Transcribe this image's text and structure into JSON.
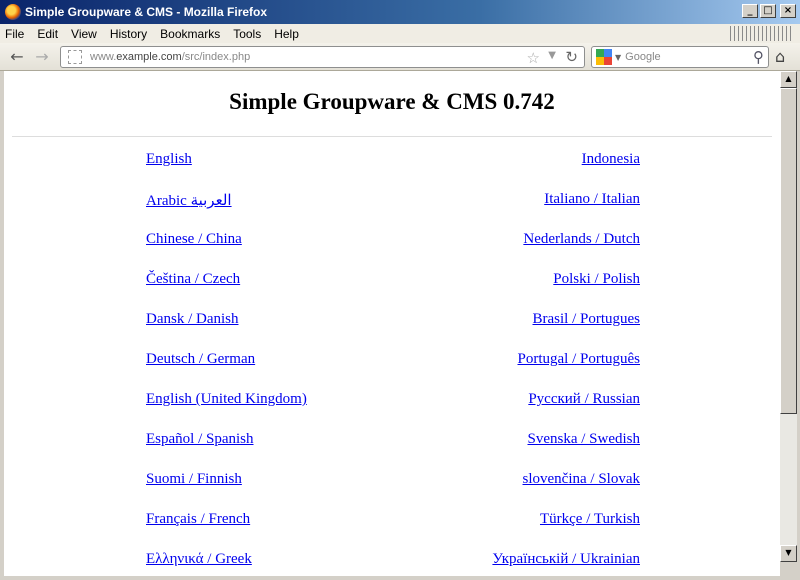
{
  "window": {
    "title": "Simple Groupware & CMS - Mozilla Firefox",
    "buttons": {
      "minimize": "_",
      "maximize": "□",
      "close": "×"
    }
  },
  "menubar": {
    "items": [
      "File",
      "Edit",
      "View",
      "History",
      "Bookmarks",
      "Tools",
      "Help"
    ]
  },
  "navbar": {
    "back_icon": "←",
    "forward_icon": "→",
    "url_prefix": "www.",
    "url_host": "example.com",
    "url_path": "/src/index.php",
    "star_icon": "☆",
    "dropdown_icon": "▼",
    "reload_icon": "↻",
    "search_placeholder": "Google",
    "search_icon": "⚲",
    "home_icon": "⌂",
    "engine_dropdown_icon": "▼"
  },
  "page": {
    "heading": "Simple Groupware & CMS 0.742",
    "languages": [
      {
        "left": "English",
        "right": "Indonesia"
      },
      {
        "left": "Arabic العربية",
        "right": "Italiano / Italian"
      },
      {
        "left": "Chinese / China",
        "right": "Nederlands / Dutch"
      },
      {
        "left": "Čeština / Czech",
        "right": "Polski / Polish"
      },
      {
        "left": "Dansk / Danish",
        "right": "Brasil / Portugues"
      },
      {
        "left": "Deutsch / German",
        "right": "Portugal / Português"
      },
      {
        "left": "English (United Kingdom)",
        "right": "Русский / Russian"
      },
      {
        "left": "Español / Spanish",
        "right": "Svenska / Swedish"
      },
      {
        "left": "Suomi / Finnish",
        "right": "slovenčina / Slovak"
      },
      {
        "left": "Français / French",
        "right": "Türkçe / Turkish"
      },
      {
        "left": "Ελληνικά / Greek",
        "right": "Українській / Ukrainian"
      }
    ]
  },
  "scrollbar": {
    "up_icon": "▲",
    "down_icon": "▼"
  },
  "colors": {
    "link": "#0000ee",
    "titlebar_start": "#0a246a",
    "titlebar_end": "#a6caf0"
  }
}
